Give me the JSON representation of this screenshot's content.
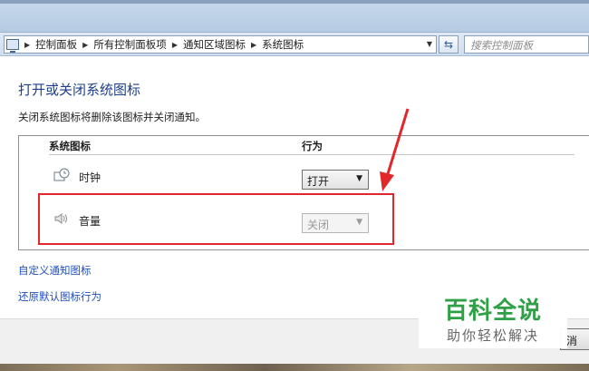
{
  "colors": {
    "title_blue": "#1e3f8a",
    "link_blue": "#1f4fbf",
    "annotation_red": "#e0282c",
    "watermark_green": "#2fa045"
  },
  "address_bar": {
    "icon": "control-panel-icon",
    "crumbs": [
      "控制面板",
      "所有控制面板项",
      "通知区域图标",
      "系统图标"
    ],
    "refresh_icon": "refresh-icon"
  },
  "search": {
    "placeholder": "搜索控制面板"
  },
  "main": {
    "title": "打开或关闭系统图标",
    "description": "关闭系统图标将删除该图标并关闭通知。"
  },
  "table": {
    "col_icon": "系统图标",
    "col_behavior": "行为",
    "rows": [
      {
        "icon": "clock-icon",
        "label": "时钟",
        "value": "打开",
        "enabled": true
      },
      {
        "icon": "speaker-icon",
        "label": "音量",
        "value": "关闭",
        "enabled": false
      }
    ]
  },
  "links": {
    "customize": "自定义通知图标",
    "restore": "还原默认图标行为"
  },
  "buttons": {
    "cancel": "消"
  },
  "watermark": {
    "main": "百科全说",
    "sub": "助你轻松解决"
  }
}
